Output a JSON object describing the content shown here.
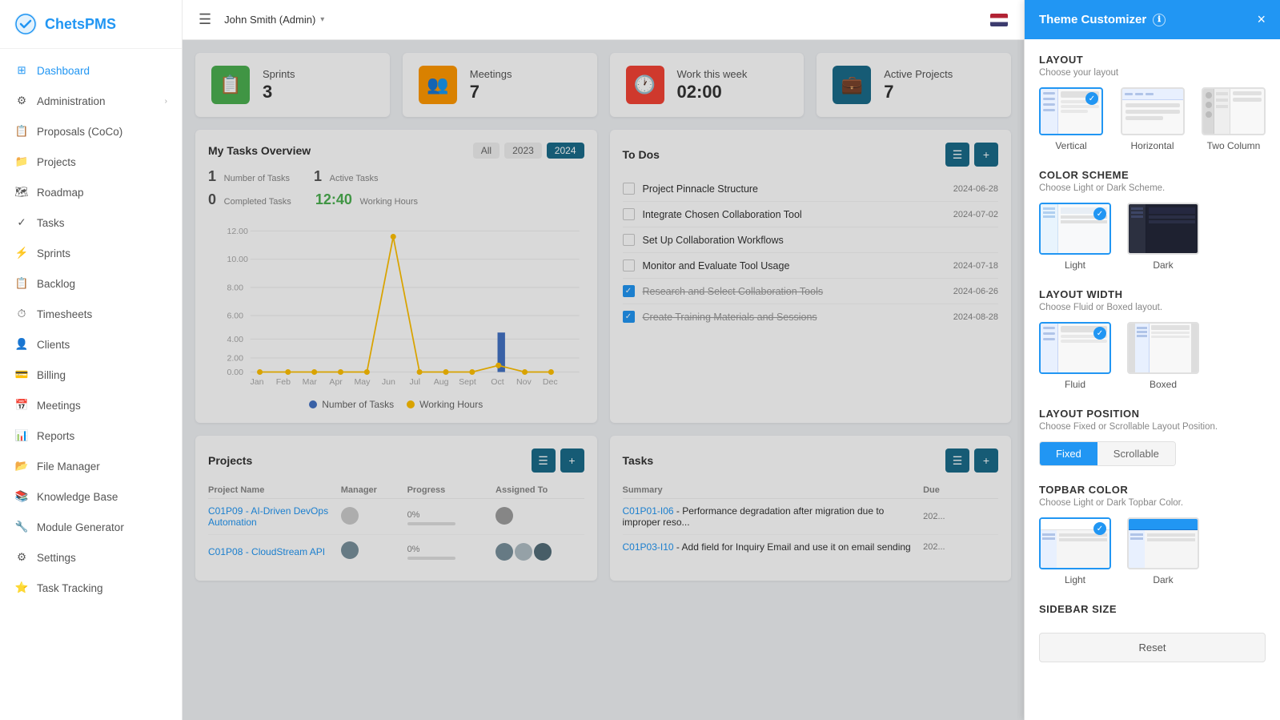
{
  "app": {
    "name": "ChetsPMS",
    "logo_text": "ChetsPMS"
  },
  "topbar": {
    "menu_icon": "☰",
    "user": "John Smith (Admin)",
    "user_arrow": "▾"
  },
  "sidebar": {
    "items": [
      {
        "id": "dashboard",
        "label": "Dashboard",
        "icon": "⊞",
        "active": true
      },
      {
        "id": "administration",
        "label": "Administration",
        "icon": "⚙",
        "arrow": "›"
      },
      {
        "id": "proposals",
        "label": "Proposals (CoCo)",
        "icon": "📋"
      },
      {
        "id": "projects",
        "label": "Projects",
        "icon": "📁"
      },
      {
        "id": "roadmap",
        "label": "Roadmap",
        "icon": "🗺"
      },
      {
        "id": "tasks",
        "label": "Tasks",
        "icon": "✓"
      },
      {
        "id": "sprints",
        "label": "Sprints",
        "icon": "⚡"
      },
      {
        "id": "backlog",
        "label": "Backlog",
        "icon": "📋"
      },
      {
        "id": "timesheets",
        "label": "Timesheets",
        "icon": "⏱"
      },
      {
        "id": "clients",
        "label": "Clients",
        "icon": "👤"
      },
      {
        "id": "billing",
        "label": "Billing",
        "icon": "💳"
      },
      {
        "id": "meetings",
        "label": "Meetings",
        "icon": "📅"
      },
      {
        "id": "reports",
        "label": "Reports",
        "icon": "📊"
      },
      {
        "id": "filemanager",
        "label": "File Manager",
        "icon": "📂"
      },
      {
        "id": "knowledgebase",
        "label": "Knowledge Base",
        "icon": "📚"
      },
      {
        "id": "modulegenerator",
        "label": "Module Generator",
        "icon": "🔧"
      },
      {
        "id": "settings",
        "label": "Settings",
        "icon": "⚙"
      },
      {
        "id": "tasktracking",
        "label": "Task Tracking",
        "icon": "⭐"
      }
    ]
  },
  "stats": [
    {
      "id": "sprints",
      "label": "Sprints",
      "value": "3",
      "icon": "📋",
      "color": "green"
    },
    {
      "id": "meetings",
      "label": "Meetings",
      "value": "7",
      "icon": "👥",
      "color": "orange"
    },
    {
      "id": "workweek",
      "label": "Work this week",
      "value": "02:00",
      "icon": "🕐",
      "color": "red"
    },
    {
      "id": "activeprojects",
      "label": "Active Projects",
      "value": "7",
      "icon": "💼",
      "color": "teal"
    }
  ],
  "tasks_overview": {
    "title": "My Tasks Overview",
    "filters": [
      "All",
      "2023",
      "2024"
    ],
    "active_filter": "2024",
    "stats": [
      {
        "label": "Number of Tasks",
        "value": "1"
      },
      {
        "label": "Active Tasks",
        "value": "1"
      },
      {
        "label": "Completed Tasks",
        "value": "0"
      },
      {
        "label": "Working Hours",
        "value": "12:40",
        "time": true
      }
    ],
    "months": [
      "Jan",
      "Feb",
      "Mar",
      "Apr",
      "May",
      "Jun",
      "Jul",
      "Aug",
      "Sept",
      "Oct",
      "Nov",
      "Dec"
    ],
    "legend": [
      {
        "label": "Number of Tasks",
        "color": "#4472c4"
      },
      {
        "label": "Working Hours",
        "color": "#ffc000"
      }
    ]
  },
  "todos": {
    "title": "To Dos",
    "items": [
      {
        "text": "Project Pinnacle Structure",
        "date": "2024-06-28",
        "checked": false
      },
      {
        "text": "Integrate Chosen Collaboration Tool",
        "date": "2024-07-02",
        "checked": false
      },
      {
        "text": "Set Up Collaboration Workflows",
        "date": "",
        "checked": false
      },
      {
        "text": "Monitor and Evaluate Tool Usage",
        "date": "2024-07-18",
        "checked": false
      },
      {
        "text": "Research and Select Collaboration Tools",
        "date": "2024-06-26",
        "checked": true
      },
      {
        "text": "Create Training Materials and Sessions",
        "date": "2024-08-28",
        "checked": true
      }
    ]
  },
  "projects": {
    "title": "Projects",
    "columns": [
      "Project Name",
      "Manager",
      "Progress",
      "Assigned To"
    ],
    "rows": [
      {
        "id": "C01P09",
        "name": "AI-Driven DevOps Automation",
        "manager": "",
        "progress": 0,
        "assigned": ""
      },
      {
        "id": "C01P08",
        "name": "CloudStream API",
        "manager": "",
        "progress": 0,
        "assigned": ""
      }
    ]
  },
  "bottom_tasks": {
    "title": "Tasks",
    "columns": [
      "Summary",
      "Due"
    ],
    "rows": [
      {
        "id": "C01P01-I06",
        "summary": "Performance degradation after migration due to improper reso...",
        "due": "202..."
      },
      {
        "id": "C01P03-I10",
        "summary": "Add field for Inquiry Email and use it on email sending",
        "due": "202..."
      }
    ]
  },
  "theme_customizer": {
    "title": "Theme Customizer",
    "info_icon": "ℹ",
    "close_icon": "×",
    "sections": {
      "layout": {
        "title": "LAYOUT",
        "subtitle": "Choose your layout",
        "options": [
          {
            "id": "vertical",
            "label": "Vertical",
            "selected": true
          },
          {
            "id": "horizontal",
            "label": "Horizontal",
            "selected": false
          },
          {
            "id": "twocolumn",
            "label": "Two Column",
            "selected": false
          }
        ]
      },
      "color_scheme": {
        "title": "COLOR SCHEME",
        "subtitle": "Choose Light or Dark Scheme.",
        "options": [
          {
            "id": "light",
            "label": "Light",
            "selected": true
          },
          {
            "id": "dark",
            "label": "Dark",
            "selected": false
          }
        ]
      },
      "layout_width": {
        "title": "LAYOUT WIDTH",
        "subtitle": "Choose Fluid or Boxed layout.",
        "options": [
          {
            "id": "fluid",
            "label": "Fluid",
            "selected": true
          },
          {
            "id": "boxed",
            "label": "Boxed",
            "selected": false
          }
        ]
      },
      "layout_position": {
        "title": "LAYOUT POSITION",
        "subtitle": "Choose Fixed or Scrollable Layout Position.",
        "options": [
          {
            "id": "fixed",
            "label": "Fixed",
            "selected": true
          },
          {
            "id": "scrollable",
            "label": "Scrollable",
            "selected": false
          }
        ]
      },
      "topbar_color": {
        "title": "TOPBAR COLOR",
        "subtitle": "Choose Light or Dark Topbar Color.",
        "options": [
          {
            "id": "light",
            "label": "Light",
            "selected": true
          },
          {
            "id": "dark",
            "label": "Dark",
            "selected": false
          }
        ]
      },
      "sidebar_size": {
        "title": "SIDEBAR SIZE"
      }
    },
    "reset_label": "Reset"
  }
}
